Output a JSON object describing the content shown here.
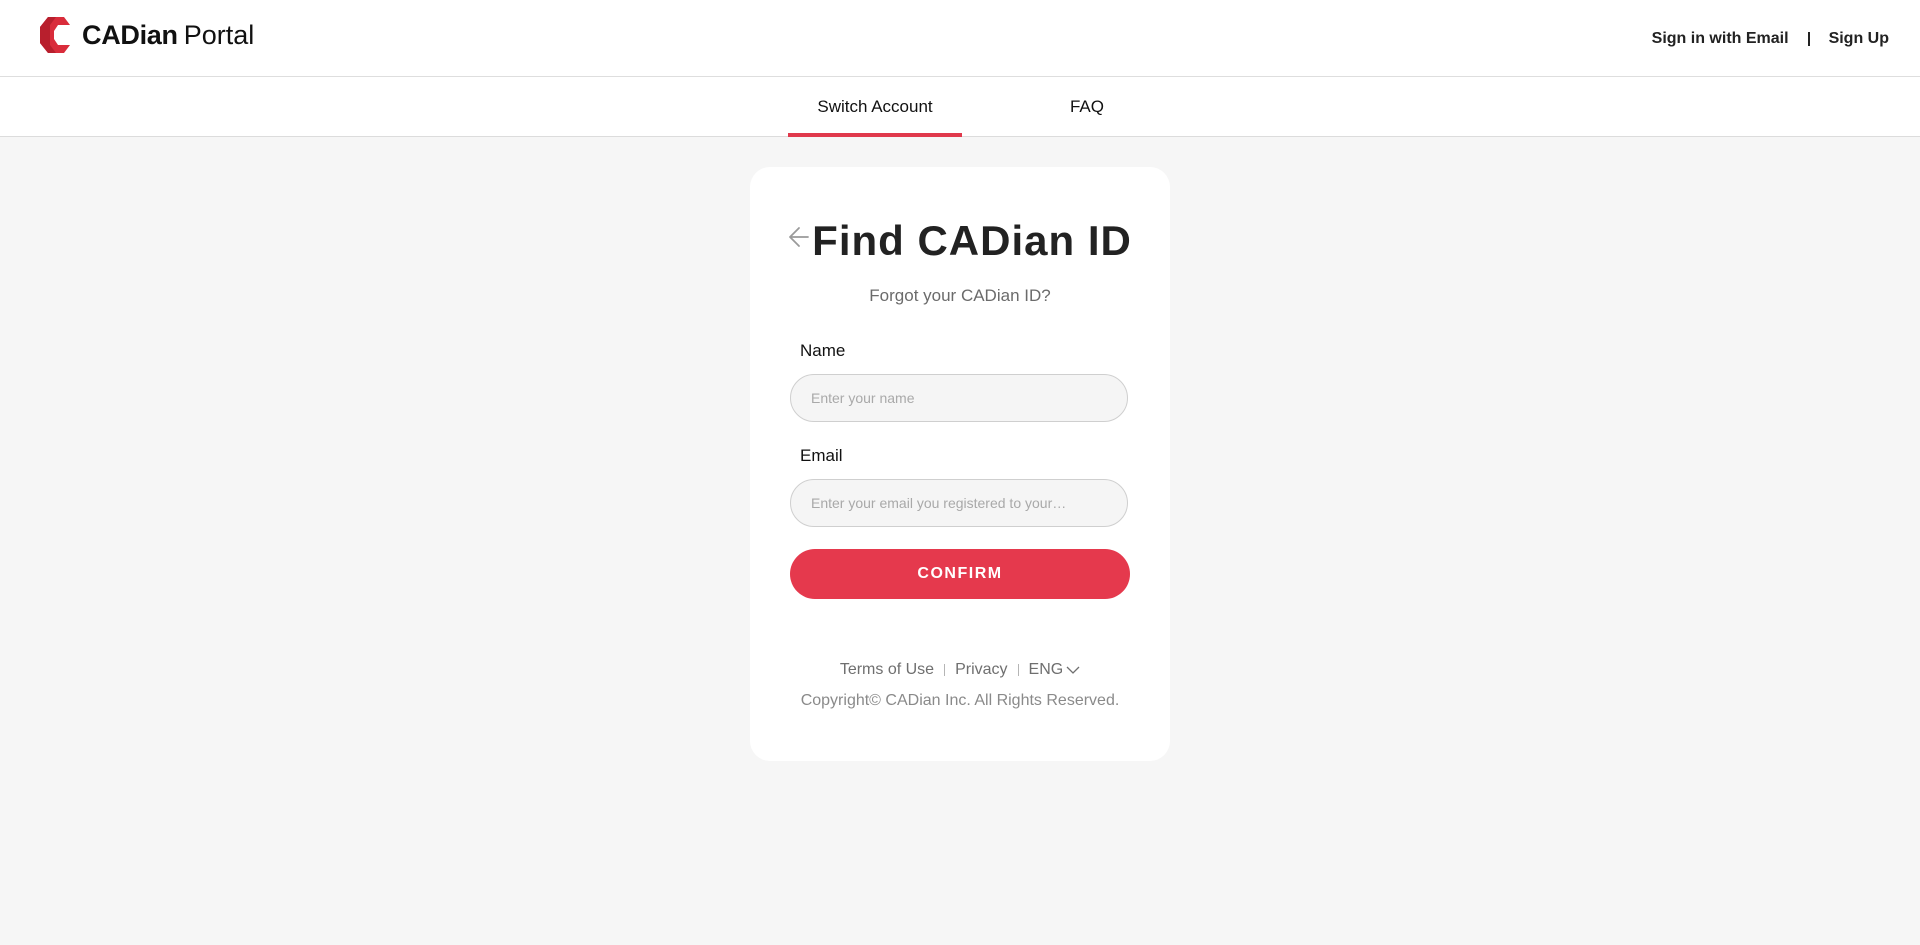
{
  "header": {
    "brand_bold": "CADian",
    "brand_light": "Portal",
    "sign_in_label": "Sign in with Email",
    "sign_up_label": "Sign Up",
    "logo_icon": "cadian-logo-icon",
    "logo_color": "#d92c3b"
  },
  "tabs": [
    {
      "label": "Switch Account",
      "active": true
    },
    {
      "label": "FAQ",
      "active": false
    }
  ],
  "card": {
    "title": "Find CADian ID",
    "subtitle": "Forgot your CADian ID?",
    "back_icon": "arrow-left-icon",
    "name_label": "Name",
    "name_placeholder": "Enter your name",
    "name_value": "",
    "email_label": "Email",
    "email_placeholder": "Enter your email you registered to your…",
    "email_value": "",
    "confirm_label": "CONFIRM"
  },
  "footer": {
    "terms_label": "Terms of Use",
    "privacy_label": "Privacy",
    "language": "ENG",
    "language_icon": "chevron-down-icon",
    "copyright": "Copyright© CADian Inc. All Rights Reserved."
  },
  "colors": {
    "accent": "#e5394d",
    "page_background": "#f6f6f6",
    "card_background": "#ffffff"
  }
}
